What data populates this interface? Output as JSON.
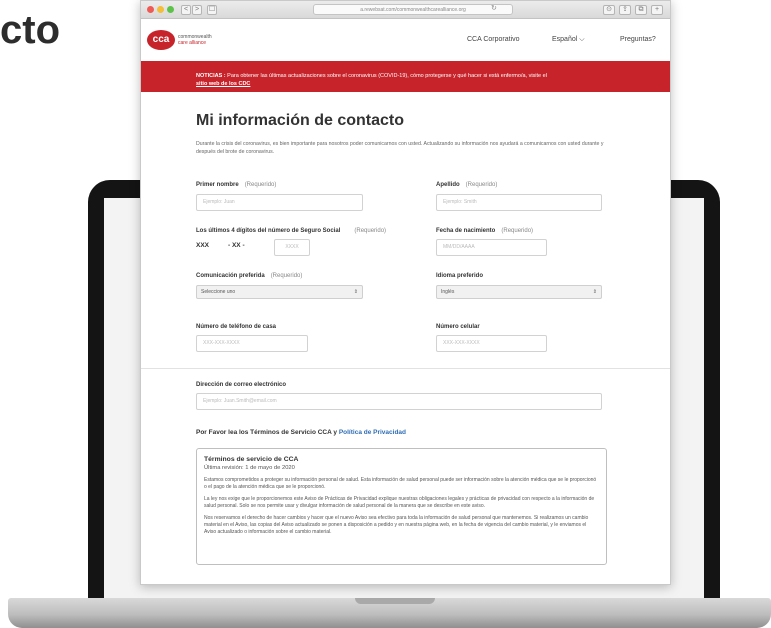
{
  "page_heading": "cto",
  "browser": {
    "url": "a.rewebsat.com/commonwealthcarealliance.org",
    "buttons": [
      "<",
      ">",
      "☐"
    ]
  },
  "header": {
    "logo_mark": "cca",
    "logo_line1": "commonwealth",
    "logo_line2": "care alliance",
    "nav": {
      "corporate": "CCA Corporativo",
      "language": "Español ⌵",
      "faq": "Preguntas?"
    }
  },
  "banner": {
    "label": "NOTICIAS :",
    "text": " Para obtener las últimas actualizaciones sobre el coronavirus (COVID-19), cómo protegerse y qué hacer si está enfermo/a, visite el",
    "link": "sitio web de los CDC"
  },
  "form": {
    "title": "Mi información de contacto",
    "intro": "Durante la crisis del coronavirus, es bien importante para nosotros poder comunicarnos con usted. Actualizando su información nos ayudará a comunicarnos con usted durante y después del brote de coronavirus.",
    "required": "(Requerido)",
    "first_name": {
      "label": "Primer nombre",
      "placeholder": "Ejemplo: Juan"
    },
    "last_name": {
      "label": "Apellido",
      "placeholder": "Ejemplo: Smith"
    },
    "ssn": {
      "label": "Los últimos 4 dígitos del número de Seguro Social",
      "prefix": "XXX",
      "middle": "- XX -",
      "placeholder": "XXXX"
    },
    "birthdate": {
      "label": "Fecha de nacimiento",
      "placeholder": "MM/DD/AAAA"
    },
    "preferred_comm": {
      "label": "Comunicación preferida",
      "value": "Seleccione uno"
    },
    "preferred_lang": {
      "label": "Idioma preferido",
      "value": "Inglés"
    },
    "home_phone": {
      "label": "Número de teléfono de casa",
      "placeholder": "XXX-XXX-XXXX"
    },
    "cell_phone": {
      "label": "Número celular",
      "placeholder": "XXX-XXX-XXXX"
    },
    "email": {
      "label": "Dirección de correo electrónico",
      "placeholder": "Ejemplo: Juan.Smith@email.com"
    }
  },
  "terms": {
    "heading": "Por Favor lea los Términos de Servicio CCA y ",
    "privacy_link": "Política de Privacidad",
    "box_title": "Términos de servicio de CCA",
    "revision": "Última revisión: 1 de mayo de 2020",
    "p1": "Estamos comprometidos a proteger su información personal de salud. Esta información de salud personal puede ser información sobre la atención médica que se le proporcionó o el pago de la atención médica que se le proporcionó.",
    "p2": "La ley nos exige que le proporcionemos este Aviso de Prácticas de Privacidad explique nuestras obligaciones legales y prácticas de privacidad con respecto a la información de salud personal. Solo se nos permite usar y divulgar información de salud personal de la manera que se describe en este aviso.",
    "p3": "Nos reservamos el derecho de hacer cambios y hacer que el nuevo Aviso sea efectivo para toda la información de salud personal que mantenemos. Si realizamos un cambio material en el Aviso, las copias del Aviso actualizado se ponen a disposición a pedido y en nuestra página web, en la fecha de vigencia del cambio material, y le enviamos el Aviso actualizado o información sobre el cambio material."
  }
}
